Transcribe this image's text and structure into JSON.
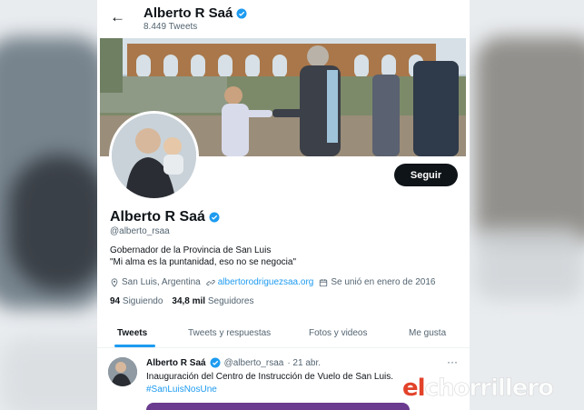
{
  "header": {
    "name": "Alberto R Saá",
    "tweets_count": "8.449 Tweets"
  },
  "profile": {
    "follow_label": "Seguir",
    "name": "Alberto R Saá",
    "handle": "@alberto_rsaa",
    "bio_line1": "Gobernador de la Provincia de San Luis",
    "bio_line2": "\"Mi alma es la puntanidad, eso no se negocia\"",
    "location": "San Luis, Argentina",
    "website": "albertorodriguezsaa.org",
    "joined": "Se unió en enero de 2016",
    "following_count": "94",
    "following_label": "Siguiendo",
    "followers_count": "34,8 mil",
    "followers_label": "Seguidores"
  },
  "tabs": [
    {
      "label": "Tweets",
      "active": true
    },
    {
      "label": "Tweets y respuestas",
      "active": false
    },
    {
      "label": "Fotos y videos",
      "active": false
    },
    {
      "label": "Me gusta",
      "active": false
    }
  ],
  "tweet": {
    "name": "Alberto R Saá",
    "handle": "@alberto_rsaa",
    "date": "· 21 abr.",
    "text": "Inauguración del Centro de Instrucción de Vuelo de San Luis.",
    "hashtag": "#SanLuisNosUne",
    "more": "···"
  },
  "watermark": {
    "first": "el",
    "rest": "chorrillero"
  },
  "colors": {
    "accent": "#1d9bf0",
    "text": "#0f1419",
    "secondary": "#536471"
  },
  "icons": [
    "back-arrow-icon",
    "verified-badge-icon",
    "location-icon",
    "link-icon",
    "calendar-icon",
    "more-icon"
  ]
}
